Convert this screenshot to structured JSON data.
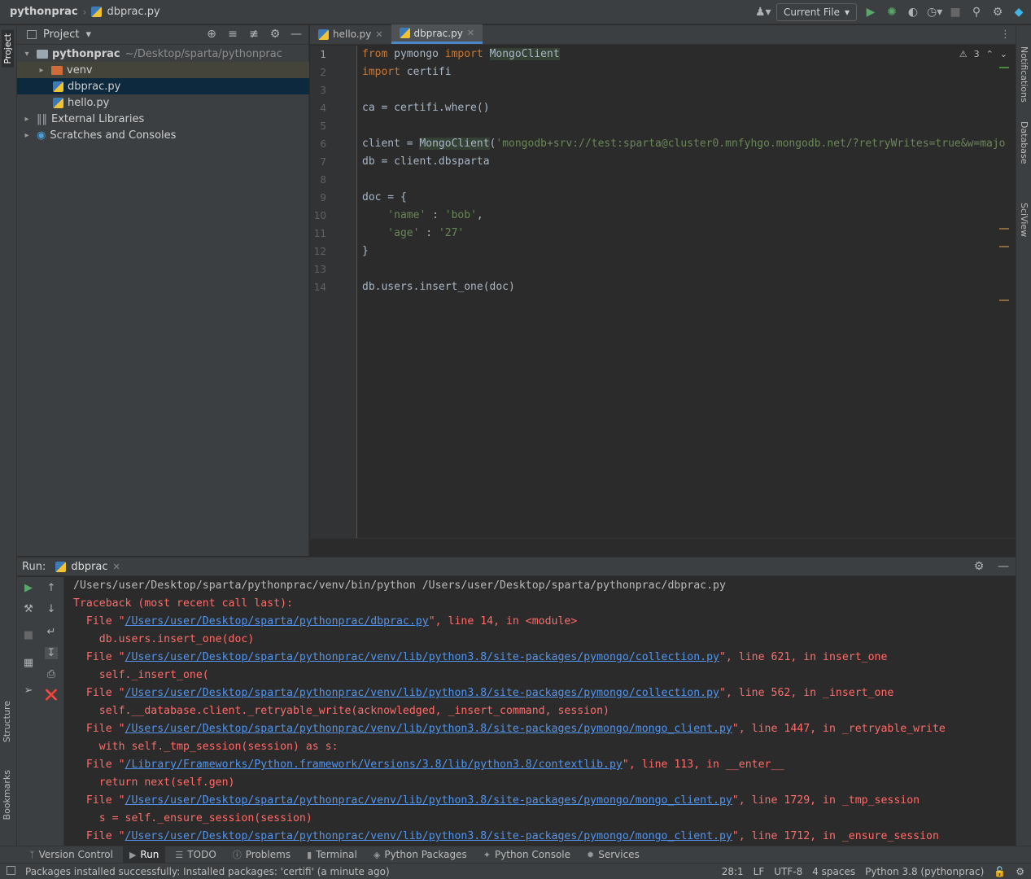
{
  "breadcrumb": {
    "project": "pythonprac",
    "separator": "›",
    "file": "dbprac.py"
  },
  "toolbar_top": {
    "run_config": "Current File"
  },
  "left_strip": {
    "project": "Project",
    "structure": "Structure",
    "bookmarks": "Bookmarks"
  },
  "right_strip": {
    "notifications": "Notifications",
    "database": "Database",
    "sciview": "SciView"
  },
  "project_panel": {
    "title": "Project",
    "tree": [
      {
        "label": "pythonprac",
        "path": "~/Desktop/sparta/pythonprac"
      },
      {
        "label": "venv"
      },
      {
        "label": "dbprac.py"
      },
      {
        "label": "hello.py"
      },
      {
        "label": "External Libraries"
      },
      {
        "label": "Scratches and Consoles"
      }
    ]
  },
  "tabs": [
    {
      "label": "hello.py"
    },
    {
      "label": "dbprac.py"
    }
  ],
  "editor": {
    "warnings": "3",
    "line_numbers": [
      "1",
      "2",
      "3",
      "4",
      "5",
      "6",
      "7",
      "8",
      "9",
      "10",
      "11",
      "12",
      "13",
      "14"
    ],
    "lines": {
      "l1": {
        "kw1": "from",
        "mod": " pymongo ",
        "kw2": "import",
        "name": "MongoClient"
      },
      "l2": {
        "kw": "import",
        "rest": " certifi"
      },
      "l4": "ca = certifi.where()",
      "l6": {
        "pre": "client = ",
        "name": "MongoClient",
        "paren": "(",
        "str": "'mongodb+srv://test:sparta@cluster0.mnfyhgo.mongodb.net/?retryWrites=true&w=majo"
      },
      "l7": "db = client.dbsparta",
      "l9": "doc = {",
      "l10": {
        "str": "    'name'",
        "rest": " : ",
        "val": "'bob'",
        "end": ","
      },
      "l11": {
        "str": "    'age'",
        "rest": " : ",
        "val": "'27'"
      },
      "l12": "}",
      "l14": "db.users.insert_one(doc)"
    }
  },
  "run_panel": {
    "label": "Run:",
    "tab": "dbprac",
    "console": [
      {
        "plain": "/Users/user/Desktop/sparta/pythonprac/venv/bin/python /Users/user/Desktop/sparta/pythonprac/dbprac.py"
      },
      {
        "text": "Traceback (most recent call last):"
      },
      {
        "pre": "  File \"",
        "link": "/Users/user/Desktop/sparta/pythonprac/dbprac.py",
        "post": "\", line 14, in <module>"
      },
      {
        "text": "    db.users.insert_one(doc)"
      },
      {
        "pre": "  File \"",
        "link": "/Users/user/Desktop/sparta/pythonprac/venv/lib/python3.8/site-packages/pymongo/collection.py",
        "post": "\", line 621, in insert_one"
      },
      {
        "text": "    self._insert_one("
      },
      {
        "pre": "  File \"",
        "link": "/Users/user/Desktop/sparta/pythonprac/venv/lib/python3.8/site-packages/pymongo/collection.py",
        "post": "\", line 562, in _insert_one"
      },
      {
        "text": "    self.__database.client._retryable_write(acknowledged, _insert_command, session)"
      },
      {
        "pre": "  File \"",
        "link": "/Users/user/Desktop/sparta/pythonprac/venv/lib/python3.8/site-packages/pymongo/mongo_client.py",
        "post": "\", line 1447, in _retryable_write"
      },
      {
        "text": "    with self._tmp_session(session) as s:"
      },
      {
        "pre": "  File \"",
        "link": "/Library/Frameworks/Python.framework/Versions/3.8/lib/python3.8/contextlib.py",
        "post": "\", line 113, in __enter__"
      },
      {
        "text": "    return next(self.gen)"
      },
      {
        "pre": "  File \"",
        "link": "/Users/user/Desktop/sparta/pythonprac/venv/lib/python3.8/site-packages/pymongo/mongo_client.py",
        "post": "\", line 1729, in _tmp_session"
      },
      {
        "text": "    s = self._ensure_session(session)"
      },
      {
        "pre": "  File \"",
        "link": "/Users/user/Desktop/sparta/pythonprac/venv/lib/python3.8/site-packages/pymongo/mongo_client.py",
        "post": "\", line 1712, in _ensure_session"
      }
    ]
  },
  "tool_windows": [
    {
      "label": "Version Control"
    },
    {
      "label": "Run"
    },
    {
      "label": "TODO"
    },
    {
      "label": "Problems"
    },
    {
      "label": "Terminal"
    },
    {
      "label": "Python Packages"
    },
    {
      "label": "Python Console"
    },
    {
      "label": "Services"
    }
  ],
  "status": {
    "message": "Packages installed successfully: Installed packages: 'certifi' (a minute ago)",
    "position": "28:1",
    "line_sep": "LF",
    "encoding": "UTF-8",
    "indent": "4 spaces",
    "interpreter": "Python 3.8 (pythonprac)"
  }
}
